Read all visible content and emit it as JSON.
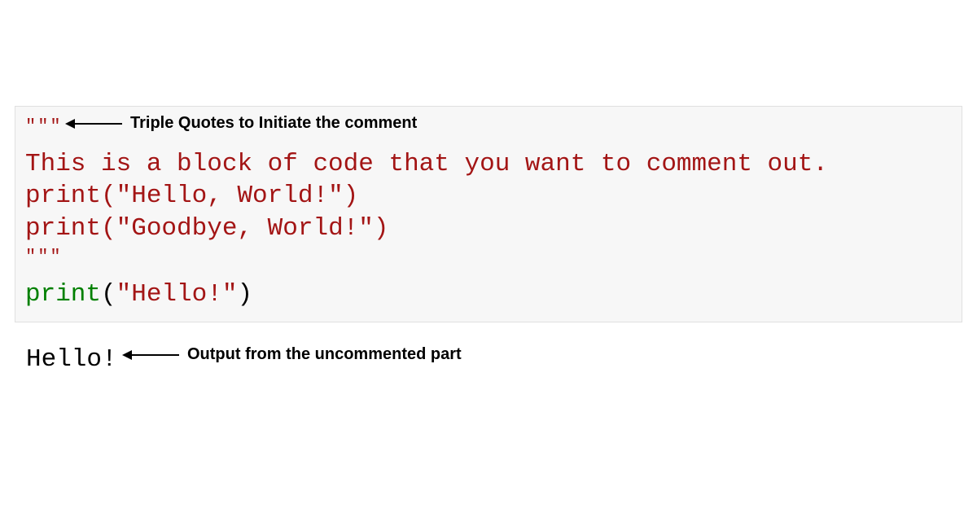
{
  "code": {
    "open_quotes": "\"\"\"",
    "line1": "This is a block of code that you want to comment out.",
    "line2_print": "print",
    "line2_open": "(",
    "line2_str": "\"Hello, World!\"",
    "line2_close": ")",
    "line3_print": "print",
    "line3_open": "(",
    "line3_str": "\"Goodbye, World!\"",
    "line3_close": ")",
    "close_quotes": "\"\"\"",
    "line4_print": "print",
    "line4_open": "(",
    "line4_str": "\"Hello!\"",
    "line4_close": ")"
  },
  "output": {
    "text": "Hello!"
  },
  "annotations": {
    "top": "Triple Quotes to Initiate the comment",
    "bottom": "Output from the uncommented part"
  }
}
